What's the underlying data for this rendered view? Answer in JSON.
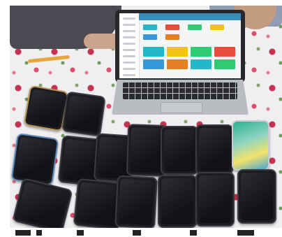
{
  "scene": {
    "description_role": "photo",
    "laptop": {
      "screen_app": "dashboard",
      "accent_color": "#3c8dbc"
    },
    "tile_colors": [
      "#21b8c9",
      "#e74c3c",
      "#2ecc71",
      "#f1c40f",
      "#3498db",
      "#e67e22"
    ],
    "lit_phone": {
      "clock_small": "",
      "clock_large": ""
    }
  }
}
